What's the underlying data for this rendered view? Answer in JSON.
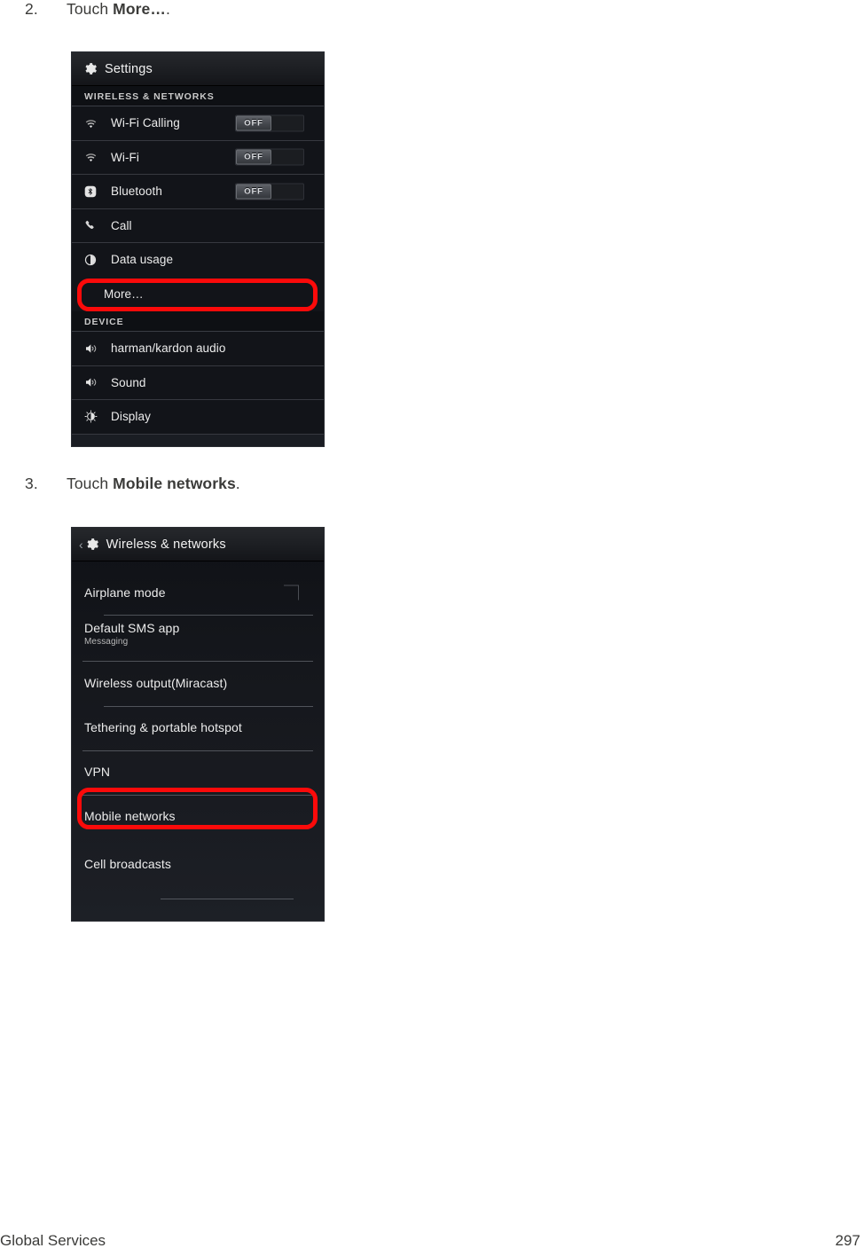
{
  "page": {
    "footer_left": "Global Services",
    "footer_page_number": "297",
    "accent_callout_color": "#fb0a0a"
  },
  "steps": [
    {
      "number": "2.",
      "prefix": "Touch ",
      "bold": "More…",
      "suffix": "."
    },
    {
      "number": "3.",
      "prefix": "Touch ",
      "bold": "Mobile networks",
      "suffix": "."
    }
  ],
  "screenshot_settings": {
    "actionbar": {
      "icon": "gear-icon",
      "title": "Settings"
    },
    "sections": [
      {
        "header": "WIRELESS & NETWORKS",
        "items": [
          {
            "icon": "wifi-icon",
            "label": "Wi-Fi Calling",
            "switch": "OFF"
          },
          {
            "icon": "wifi-icon",
            "label": "Wi-Fi",
            "switch": "OFF"
          },
          {
            "icon": "bluetooth-icon",
            "label": "Bluetooth",
            "switch": "OFF"
          },
          {
            "icon": "phone-icon",
            "label": "Call"
          },
          {
            "icon": "data-usage-icon",
            "label": "Data usage"
          },
          {
            "icon": "none",
            "label": "More…",
            "highlighted": true
          }
        ]
      },
      {
        "header": "DEVICE",
        "items": [
          {
            "icon": "speaker-icon",
            "label": "harman/kardon audio"
          },
          {
            "icon": "speaker-icon",
            "label": "Sound"
          },
          {
            "icon": "brightness-icon",
            "label": "Display"
          }
        ]
      }
    ]
  },
  "screenshot_wireless": {
    "actionbar": {
      "back": "‹",
      "icon": "gear-icon",
      "title": "Wireless & networks"
    },
    "items": [
      {
        "label": "Airplane mode",
        "control": "checkbox-unchecked"
      },
      {
        "label": "Default SMS app",
        "sublabel": "Messaging"
      },
      {
        "label": "Wireless output(Miracast)"
      },
      {
        "label": "Tethering & portable hotspot"
      },
      {
        "label": "VPN"
      },
      {
        "label": "Mobile networks",
        "highlighted": true
      },
      {
        "label": "Cell broadcasts"
      }
    ]
  }
}
